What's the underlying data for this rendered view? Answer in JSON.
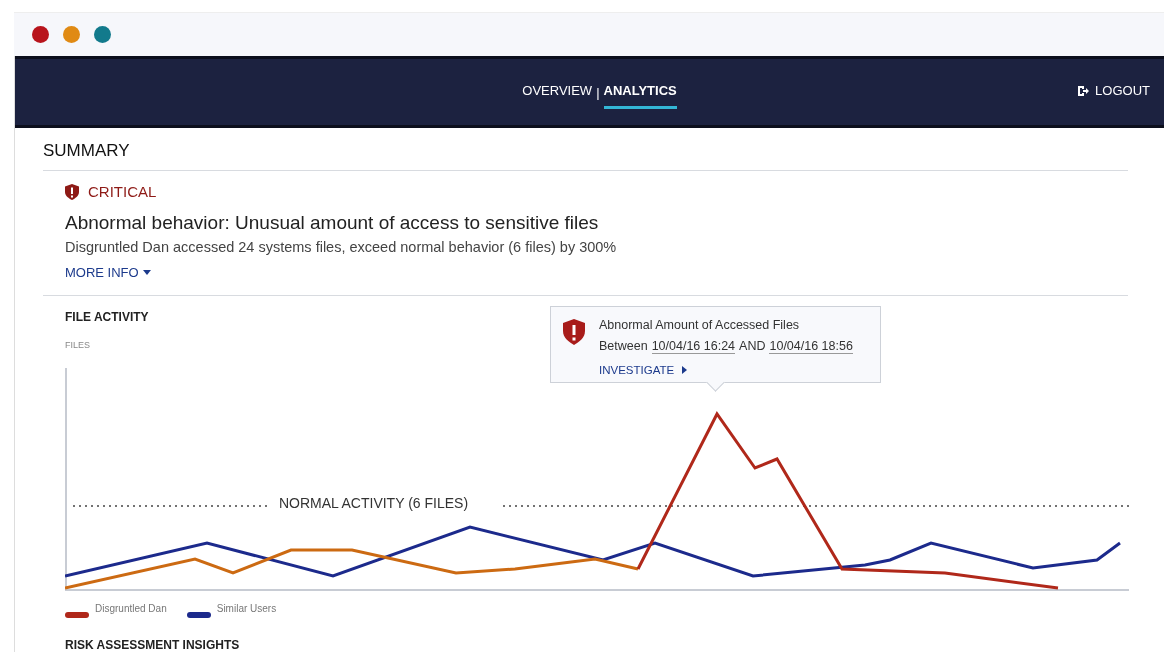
{
  "nav": {
    "tabs": [
      {
        "label": "OVERVIEW",
        "selected": false
      },
      {
        "label": "ANALYTICS",
        "selected": true
      }
    ],
    "separator": "|",
    "logout": "LOGOUT"
  },
  "summary": {
    "heading": "SUMMARY",
    "severity": "CRITICAL",
    "title": "Abnormal behavior: Unusual amount of access to sensitive files",
    "description": "Disgruntled Dan accessed 24 systems files, exceed normal behavior (6 files) by 300%",
    "more_info": "MORE INFO"
  },
  "file_activity": {
    "heading": "FILE ACTIVITY",
    "axis_label": "FILES",
    "threshold_label": "NORMAL ACTIVITY (6 FILES)",
    "tooltip": {
      "title": "Abnormal Amount of Accessed Files",
      "between": "Between",
      "start": "10/04/16 16:24",
      "and": "AND",
      "end": "10/04/16 18:56",
      "action": "INVESTIGATE"
    },
    "legend": [
      {
        "name": "Disgruntled Dan",
        "color": "#b0281a"
      },
      {
        "name": "Similar Users",
        "color": "#1c2a8c"
      }
    ]
  },
  "next_section": "RISK ASSESSMENT INSIGHTS"
}
